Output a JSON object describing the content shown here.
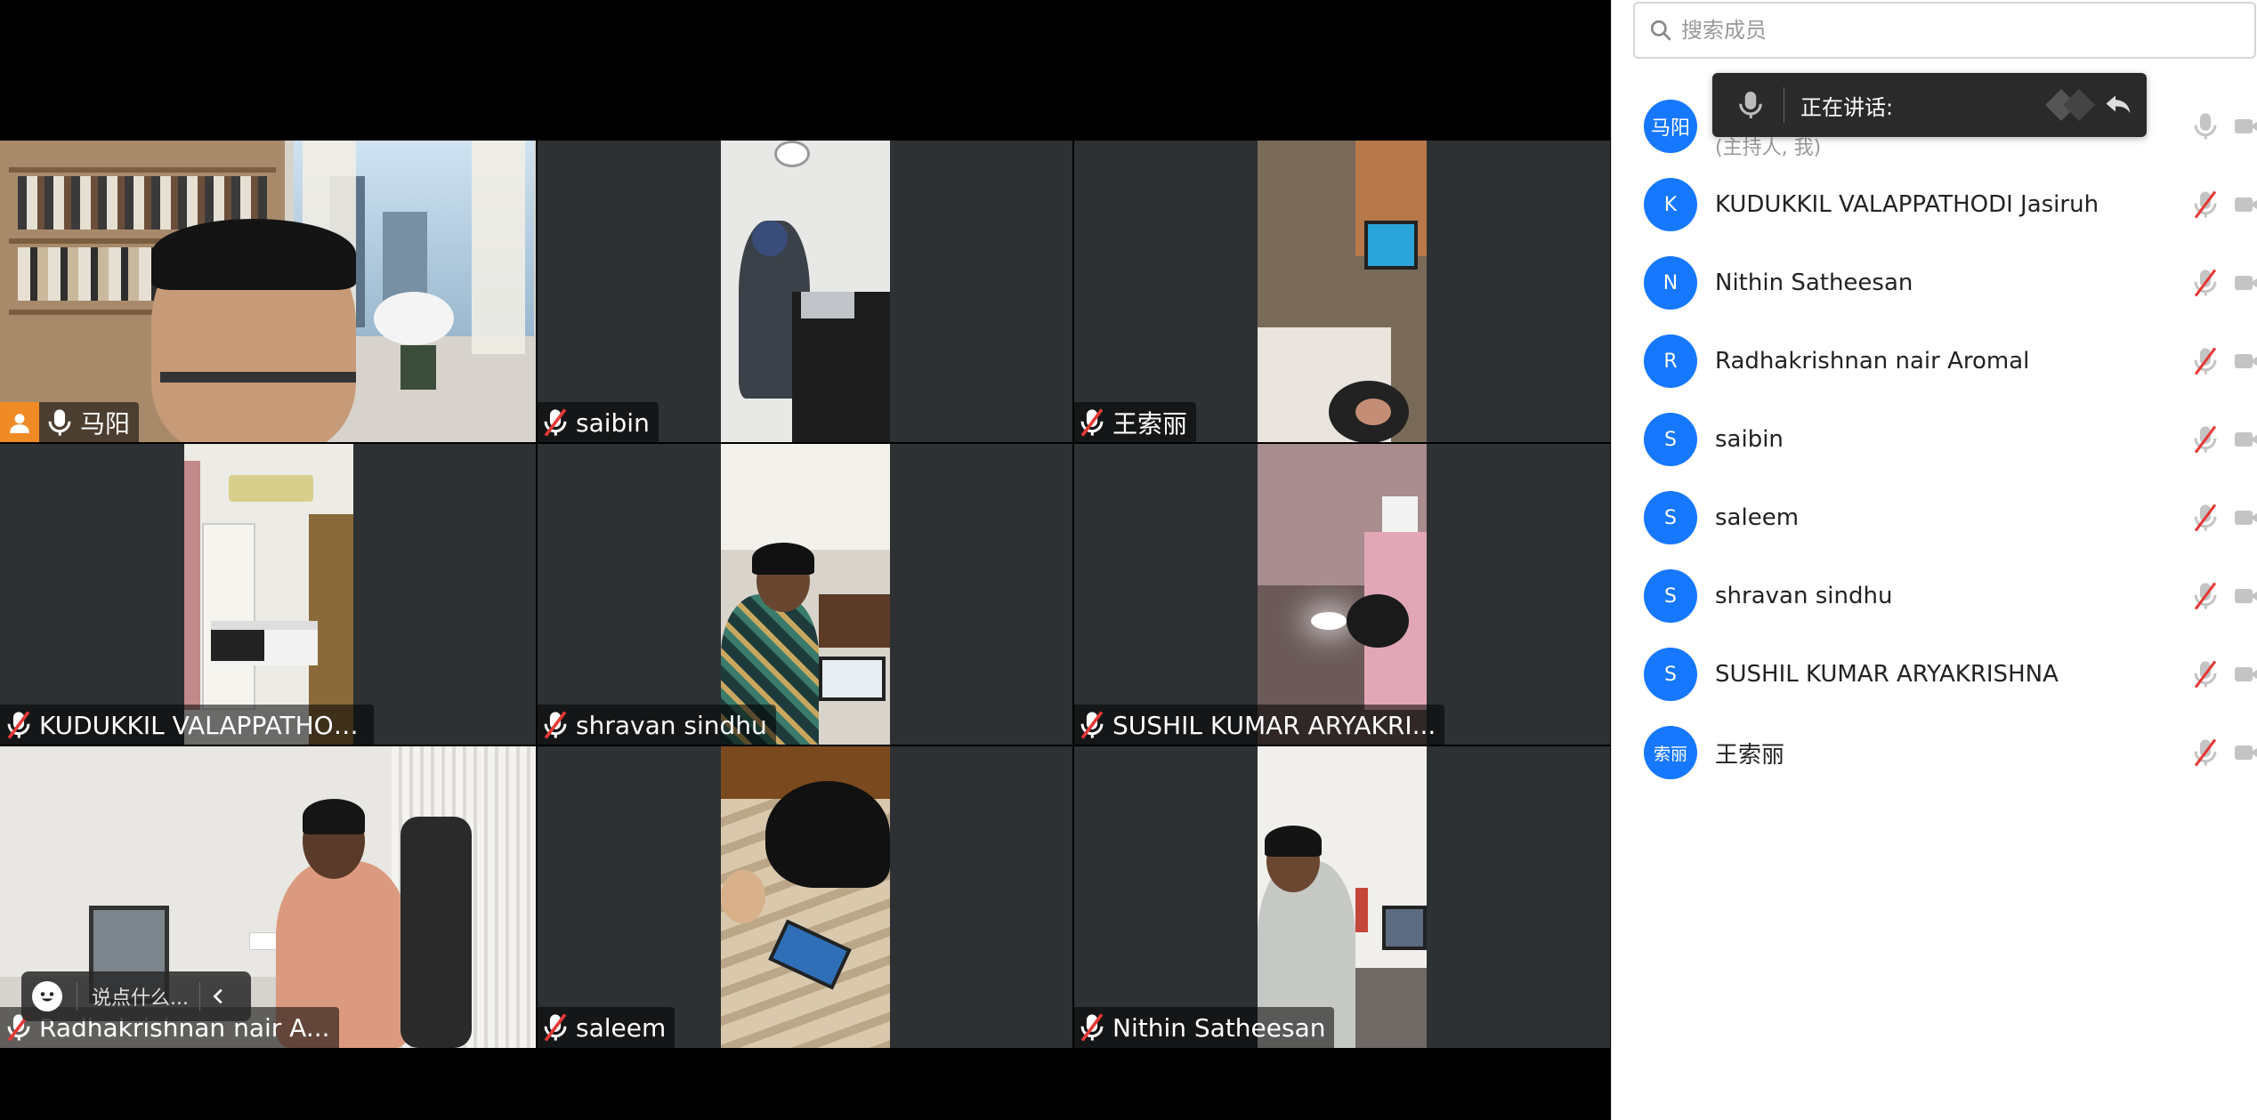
{
  "video_grid": {
    "tiles": [
      {
        "name": "马阳",
        "is_host": true,
        "muted": false
      },
      {
        "name": "saibin",
        "is_host": false,
        "muted": true
      },
      {
        "name": "王索丽",
        "is_host": false,
        "muted": true
      },
      {
        "name": "KUDUKKIL VALAPPATHOD...",
        "is_host": false,
        "muted": true
      },
      {
        "name": "shravan sindhu",
        "is_host": false,
        "muted": true
      },
      {
        "name": "SUSHIL KUMAR ARYAKRI...",
        "is_host": false,
        "muted": true
      },
      {
        "name": "Radhakrishnan nair A...",
        "is_host": false,
        "muted": true
      },
      {
        "name": "saleem",
        "is_host": false,
        "muted": true
      },
      {
        "name": "Nithin Satheesan",
        "is_host": false,
        "muted": true
      }
    ]
  },
  "chat_bar": {
    "placeholder": "说点什么..."
  },
  "speaking_popup": {
    "label": "正在讲话:"
  },
  "member_panel": {
    "search_placeholder": "搜索成员",
    "members": [
      {
        "avatar_text": "马阳",
        "name": "",
        "sub": "(主持人, 我)",
        "muted": false
      },
      {
        "avatar_text": "K",
        "name": "KUDUKKIL VALAPPATHODI Jasiruh",
        "muted": true
      },
      {
        "avatar_text": "N",
        "name": "Nithin Satheesan",
        "muted": true
      },
      {
        "avatar_text": "R",
        "name": "Radhakrishnan nair Aromal",
        "muted": true
      },
      {
        "avatar_text": "S",
        "name": "saibin",
        "muted": true
      },
      {
        "avatar_text": "S",
        "name": "saleem",
        "muted": true
      },
      {
        "avatar_text": "S",
        "name": "shravan sindhu",
        "muted": true
      },
      {
        "avatar_text": "S",
        "name": "SUSHIL KUMAR ARYAKRISHNA",
        "muted": true
      },
      {
        "avatar_text": "索丽",
        "name": "王索丽",
        "muted": true
      }
    ]
  },
  "colors": {
    "avatar_blue": "#1677ff",
    "host_orange": "#f08a24",
    "muted_red": "#e53935",
    "tile_bg": "#2d3133"
  },
  "icons": [
    "search-icon",
    "mic-icon",
    "mic-muted-icon",
    "camera-off-icon",
    "host-person-icon",
    "emoji-icon",
    "chevron-left-icon",
    "undo-icon"
  ]
}
